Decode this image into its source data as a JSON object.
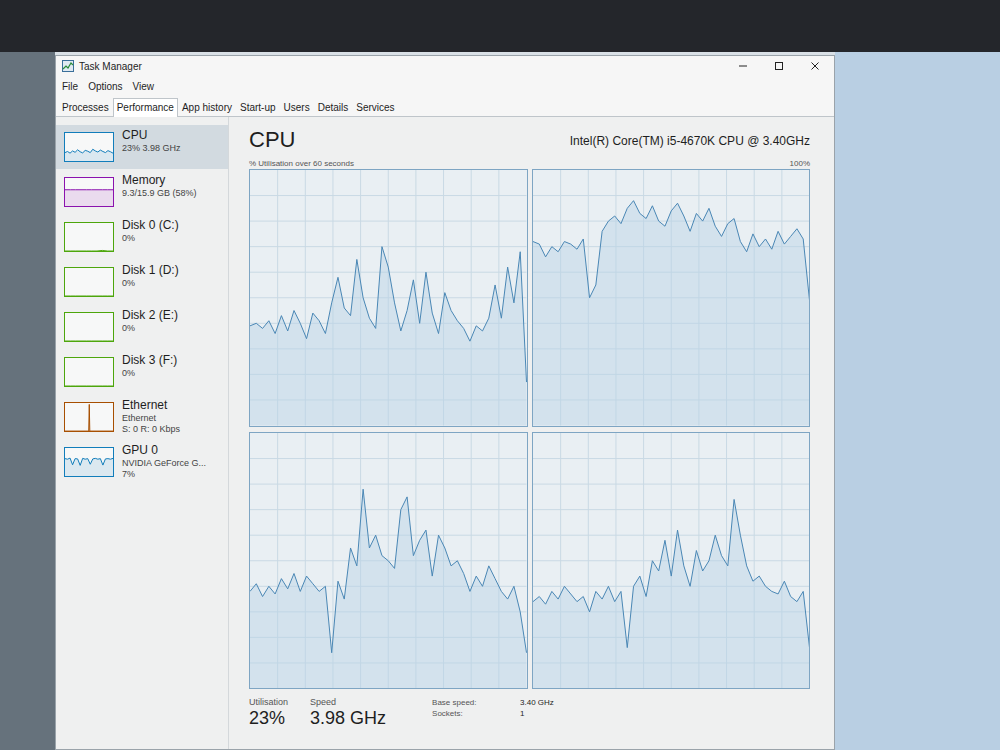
{
  "window": {
    "title": "Task Manager"
  },
  "menu": [
    {
      "label": "File"
    },
    {
      "label": "Options"
    },
    {
      "label": "View"
    }
  ],
  "tabs": [
    {
      "label": "Processes",
      "selected": false
    },
    {
      "label": "Performance",
      "selected": true
    },
    {
      "label": "App history",
      "selected": false
    },
    {
      "label": "Start-up",
      "selected": false
    },
    {
      "label": "Users",
      "selected": false
    },
    {
      "label": "Details",
      "selected": false
    },
    {
      "label": "Services",
      "selected": false
    }
  ],
  "sidebar": {
    "items": [
      {
        "name": "CPU",
        "details": [
          "23% 3.98 GHz"
        ],
        "selected": true,
        "color": "#117dbb",
        "values": [
          30,
          34,
          28,
          36,
          31,
          40,
          33,
          29,
          38,
          35,
          30,
          42,
          36,
          32,
          39,
          34,
          30,
          37,
          33,
          28
        ]
      },
      {
        "name": "Memory",
        "details": [
          "9.3/15.9 GB (58%)"
        ],
        "selected": false,
        "color": "#8b12ae",
        "values": [
          58,
          58,
          58,
          58,
          58,
          58,
          58,
          58,
          58,
          58
        ]
      },
      {
        "name": "Disk 0 (C:)",
        "details": [
          "0%"
        ],
        "selected": false,
        "color": "#4da60c",
        "values": [
          0,
          0,
          0,
          0,
          0,
          0,
          0,
          2,
          0,
          0
        ]
      },
      {
        "name": "Disk 1 (D:)",
        "details": [
          "0%"
        ],
        "selected": false,
        "color": "#4da60c",
        "values": [
          0,
          0,
          0,
          0,
          0,
          0,
          0,
          0,
          0,
          0
        ]
      },
      {
        "name": "Disk 2 (E:)",
        "details": [
          "0%"
        ],
        "selected": false,
        "color": "#4da60c",
        "values": [
          0,
          0,
          0,
          0,
          0,
          0,
          0,
          0,
          0,
          0
        ]
      },
      {
        "name": "Disk 3 (F:)",
        "details": [
          "0%"
        ],
        "selected": false,
        "color": "#4da60c",
        "values": [
          0,
          0,
          0,
          0,
          0,
          0,
          0,
          0,
          0,
          0
        ]
      },
      {
        "name": "Ethernet",
        "details": [
          "Ethernet",
          "S: 0 R: 0 Kbps"
        ],
        "selected": false,
        "color": "#a74f01",
        "values": [
          0,
          0,
          0,
          0,
          0,
          0,
          0,
          0,
          0,
          0,
          0,
          0,
          0,
          0,
          0,
          0,
          0,
          0,
          0,
          0,
          0,
          0,
          0,
          0,
          0,
          0,
          0,
          0,
          0,
          0,
          0,
          0,
          0,
          0,
          0,
          0,
          0,
          0,
          0,
          0,
          0,
          0,
          0,
          0,
          0,
          95,
          0,
          0,
          0,
          0,
          0,
          0,
          0,
          0,
          0,
          0,
          0,
          0,
          0,
          0,
          0,
          0,
          0,
          0,
          0,
          0,
          0,
          0,
          0,
          0,
          0,
          0,
          0,
          0,
          0,
          0,
          0,
          0,
          0,
          0,
          0,
          0,
          0,
          0,
          0,
          0,
          0,
          0,
          0,
          0
        ]
      },
      {
        "name": "GPU 0",
        "details": [
          "NVIDIA GeForce G...",
          "7%"
        ],
        "selected": false,
        "color": "#117dbb",
        "values": [
          62,
          60,
          64,
          40,
          62,
          61,
          38,
          63,
          60,
          62,
          42,
          61,
          63,
          60,
          62,
          39,
          61,
          62,
          60,
          63
        ]
      }
    ]
  },
  "cpu": {
    "title": "CPU",
    "model": "Intel(R) Core(TM) i5-4670K CPU @ 3.40GHz",
    "axis_label": "% Utilisation over 60 seconds",
    "axis_max": "100%",
    "cores": [
      {
        "values": [
          39,
          40,
          38,
          41,
          36,
          43,
          37,
          45,
          40,
          34,
          44,
          41,
          36,
          48,
          58,
          46,
          43,
          65,
          50,
          42,
          38,
          70,
          62,
          48,
          37,
          45,
          57,
          40,
          60,
          44,
          36,
          52,
          45,
          41,
          38,
          33,
          39,
          37,
          42,
          55,
          42,
          62,
          48,
          68,
          17
        ]
      },
      {
        "values": [
          72,
          71,
          66,
          70,
          68,
          72,
          71,
          69,
          73,
          50,
          55,
          76,
          80,
          82,
          79,
          85,
          88,
          83,
          81,
          86,
          80,
          78,
          84,
          87,
          82,
          76,
          83,
          80,
          85,
          78,
          74,
          79,
          81,
          72,
          68,
          75,
          70,
          73,
          69,
          76,
          71,
          74,
          77,
          73,
          49
        ]
      },
      {
        "values": [
          38,
          41,
          36,
          40,
          37,
          43,
          39,
          45,
          38,
          44,
          41,
          38,
          40,
          14,
          42,
          35,
          55,
          48,
          78,
          55,
          60,
          52,
          50,
          47,
          70,
          75,
          52,
          58,
          62,
          44,
          60,
          55,
          48,
          50,
          45,
          38,
          44,
          40,
          48,
          43,
          38,
          35,
          40,
          30,
          14
        ]
      },
      {
        "values": [
          34,
          36,
          33,
          38,
          35,
          40,
          37,
          34,
          36,
          30,
          38,
          35,
          40,
          34,
          38,
          16,
          40,
          44,
          36,
          50,
          46,
          58,
          44,
          62,
          48,
          40,
          54,
          46,
          50,
          60,
          52,
          48,
          74,
          60,
          48,
          42,
          44,
          40,
          38,
          37,
          42,
          36,
          34,
          38,
          16
        ]
      }
    ]
  },
  "stats": [
    {
      "label": "Utilisation",
      "value": "23%"
    },
    {
      "label": "Speed",
      "value": "3.98 GHz"
    }
  ],
  "specs": [
    {
      "label": "Base speed:",
      "value": "3.40 GHz"
    },
    {
      "label": "Sockets:",
      "value": "1"
    }
  ]
}
